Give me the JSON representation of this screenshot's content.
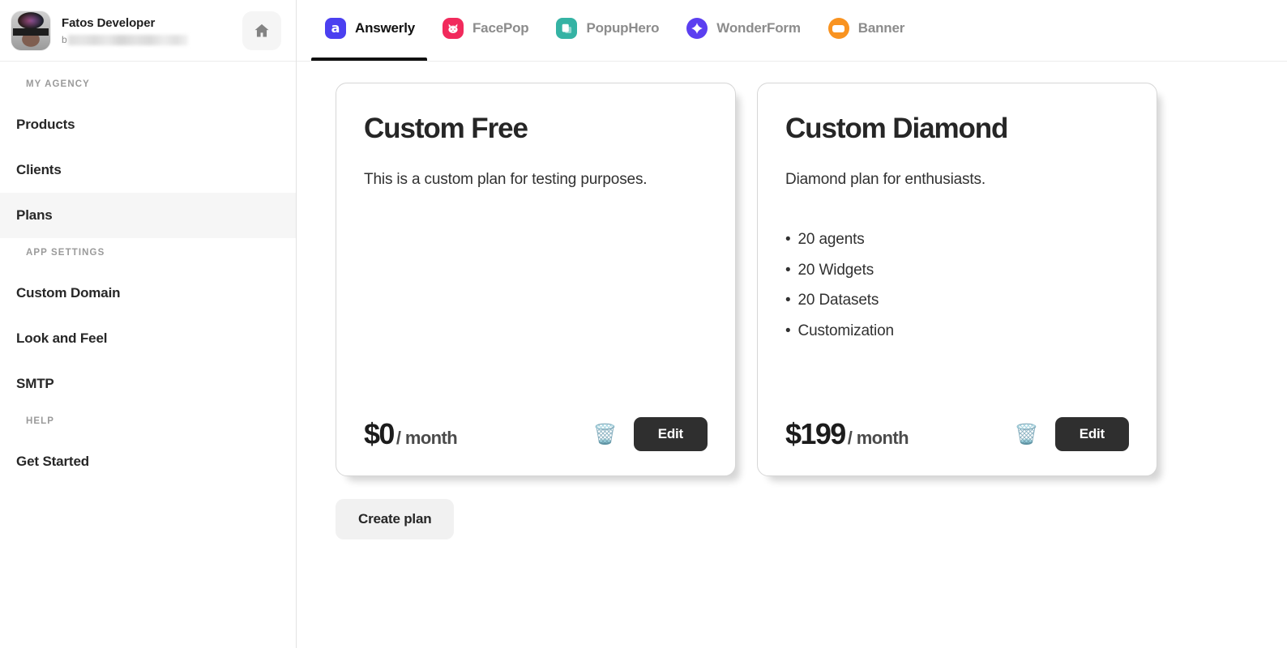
{
  "sidebar": {
    "profile": {
      "name": "Fatos Developer",
      "email_visible_prefix": "b",
      "avatar_icon": "user-avatar-photo",
      "home_icon": "home-icon"
    },
    "sections": [
      {
        "title": "MY AGENCY",
        "items": [
          {
            "label": "Products",
            "active": false
          },
          {
            "label": "Clients",
            "active": false
          },
          {
            "label": "Plans",
            "active": true
          }
        ]
      },
      {
        "title": "APP SETTINGS",
        "items": [
          {
            "label": "Custom Domain",
            "active": false
          },
          {
            "label": "Look and Feel",
            "active": false
          },
          {
            "label": "SMTP",
            "active": false
          }
        ]
      },
      {
        "title": "HELP",
        "items": [
          {
            "label": "Get Started",
            "active": false
          }
        ]
      }
    ]
  },
  "tabs": [
    {
      "label": "Answerly",
      "icon": "answerly-logo-icon",
      "color": "#4b40f0",
      "active": true
    },
    {
      "label": "FacePop",
      "icon": "facepop-cat-icon",
      "color": "#f12a5c",
      "active": false
    },
    {
      "label": "PopupHero",
      "icon": "popuphero-window-icon",
      "color": "#35b3a4",
      "active": false
    },
    {
      "label": "WonderForm",
      "icon": "wonderform-spark-icon",
      "color": "#5b3ff0",
      "active": false
    },
    {
      "label": "Banner",
      "icon": "banner-bar-icon",
      "color": "#f99320",
      "active": false
    }
  ],
  "plans": [
    {
      "title": "Custom Free",
      "description": "This is a custom plan for testing purposes.",
      "features": [],
      "price_amount": "$0",
      "price_period": "/ month",
      "delete_icon": "trash-icon",
      "delete_glyph": "🗑️",
      "edit_label": "Edit"
    },
    {
      "title": "Custom Diamond",
      "description": "Diamond plan for enthusiasts.",
      "features": [
        "20 agents",
        "20 Widgets",
        "20 Datasets",
        "Customization"
      ],
      "price_amount": "$199",
      "price_period": "/ month",
      "delete_icon": "trash-icon",
      "delete_glyph": "🗑️",
      "edit_label": "Edit"
    }
  ],
  "actions": {
    "create_plan_label": "Create plan"
  },
  "bullet_char": "•"
}
